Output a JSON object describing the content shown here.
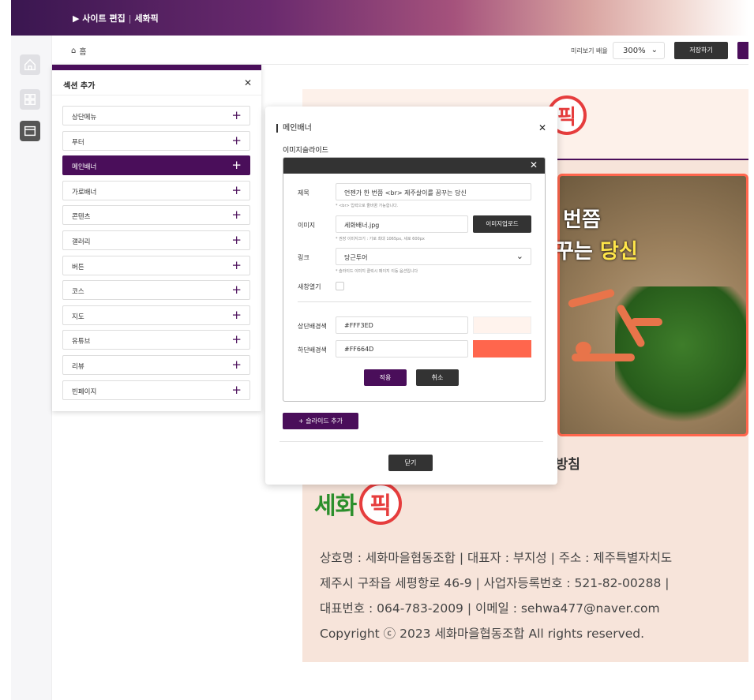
{
  "topbar": {
    "breadcrumb_prefix": "▶ 사이트 편집",
    "site_name": "세화픽"
  },
  "subheader": {
    "home_label": "홈",
    "zoom_label": "미리보기 배율",
    "zoom_value": "300%",
    "save_label": "저장하기"
  },
  "section_panel": {
    "title": "섹션 추가",
    "items": [
      {
        "label": "상단메뉴"
      },
      {
        "label": "푸터"
      },
      {
        "label": "메인배너"
      },
      {
        "label": "가로배너"
      },
      {
        "label": "콘텐츠"
      },
      {
        "label": "갤러리"
      },
      {
        "label": "버튼"
      },
      {
        "label": "코스"
      },
      {
        "label": "지도"
      },
      {
        "label": "유튜브"
      },
      {
        "label": "리뷰"
      },
      {
        "label": "빈페이지"
      }
    ],
    "active_index": 2
  },
  "modal": {
    "title": "메인배너",
    "subtitle": "이미지슬라이드",
    "fields": {
      "title_label": "제목",
      "title_value": "언젠가 한 번쯤 <br> 제주살이를 꿈꾸는 당신",
      "title_hint": "* <br> 입력으로 줄바꿈 가능합니다.",
      "image_label": "이미지",
      "image_value": "세화배너.jpg",
      "image_hint": "* 권장 이미지크기 : 가로 최대 1065px, 세로 600px",
      "upload_label": "이미지업로드",
      "link_label": "링크",
      "link_value": "당근투어",
      "link_hint": "* 슬라이드 이미지 클릭시 페이지 이동 옵션입니다",
      "newwin_label": "새창열기",
      "top_bg_label": "상단배경색",
      "top_bg_value": "#FFF3ED",
      "bottom_bg_label": "하단배경색",
      "bottom_bg_value": "#FF664D"
    },
    "apply_label": "적용",
    "cancel_label": "취소",
    "add_slide_label": "+ 슬라이드 추가",
    "close_label": "닫기"
  },
  "preview": {
    "banner_line1": "번쯤",
    "banner_line2_prefix": "꾸는 ",
    "banner_line2_highlight": "당신",
    "privacy_fragment": "리방침",
    "logo_text": "세화",
    "logo_bubble": "픽",
    "footer_lines": [
      "상호명 : 세화마을협동조합  |  대표자 : 부지성  |  주소 : 제주특별자치도",
      "제주시 구좌읍 세평항로 46-9  |  사업자등록번호 : 521-82-00288  |",
      "대표번호 : 064-783-2009  |  이메일 : sehwa477@naver.com",
      "Copyright ⓒ 2023 세화마을협동조합 All rights reserved."
    ]
  },
  "colors": {
    "brand_purple": "#4A0E5A",
    "accent_coral": "#FF664D",
    "top_bg": "#FFF3ED"
  },
  "icons": [
    "home-icon",
    "layout-icon",
    "window-icon",
    "plus-icon",
    "close-icon",
    "chevron-down-icon"
  ]
}
